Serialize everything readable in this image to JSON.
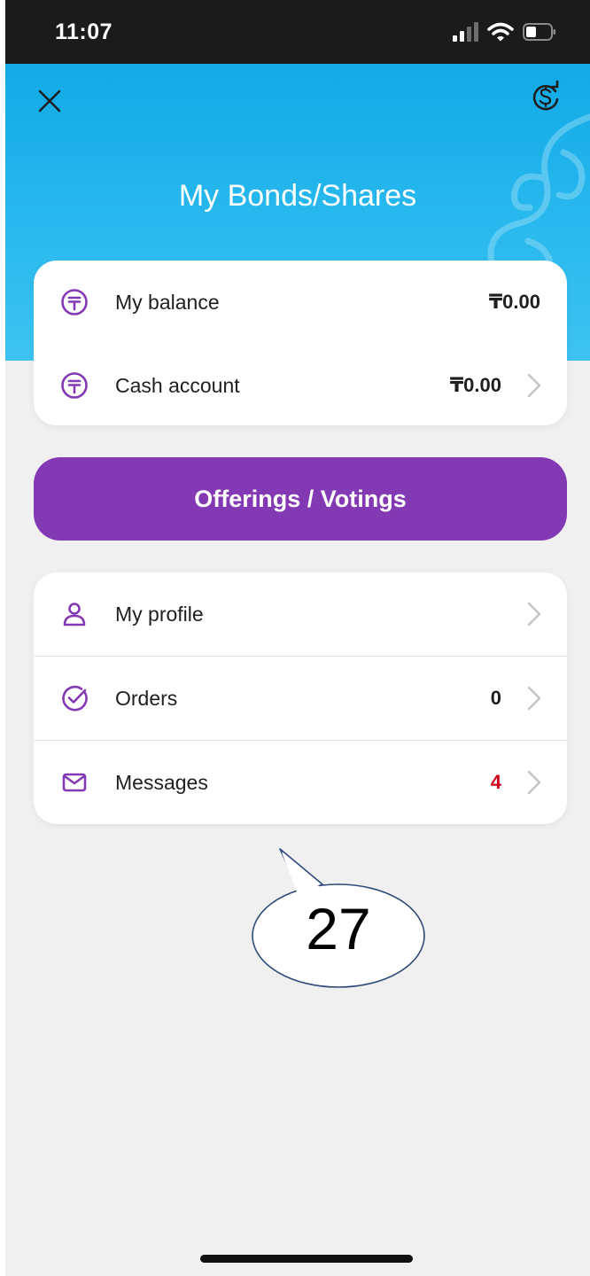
{
  "status_bar": {
    "time": "11:07"
  },
  "header": {
    "title": "My Bonds/Shares"
  },
  "balance": {
    "rows": [
      {
        "label": "My balance",
        "value": "₸0.00"
      },
      {
        "label": "Cash account",
        "value": "₸0.00"
      }
    ]
  },
  "offerings_button": {
    "label": "Offerings / Votings"
  },
  "menu": {
    "items": [
      {
        "label": "My profile",
        "value": ""
      },
      {
        "label": "Orders",
        "value": "0"
      },
      {
        "label": "Messages",
        "value": "4"
      }
    ]
  },
  "annotation": {
    "text": "27"
  },
  "colors": {
    "accent": "#8439b4",
    "header": "#1eb0ea",
    "alert": "#d0021b"
  }
}
